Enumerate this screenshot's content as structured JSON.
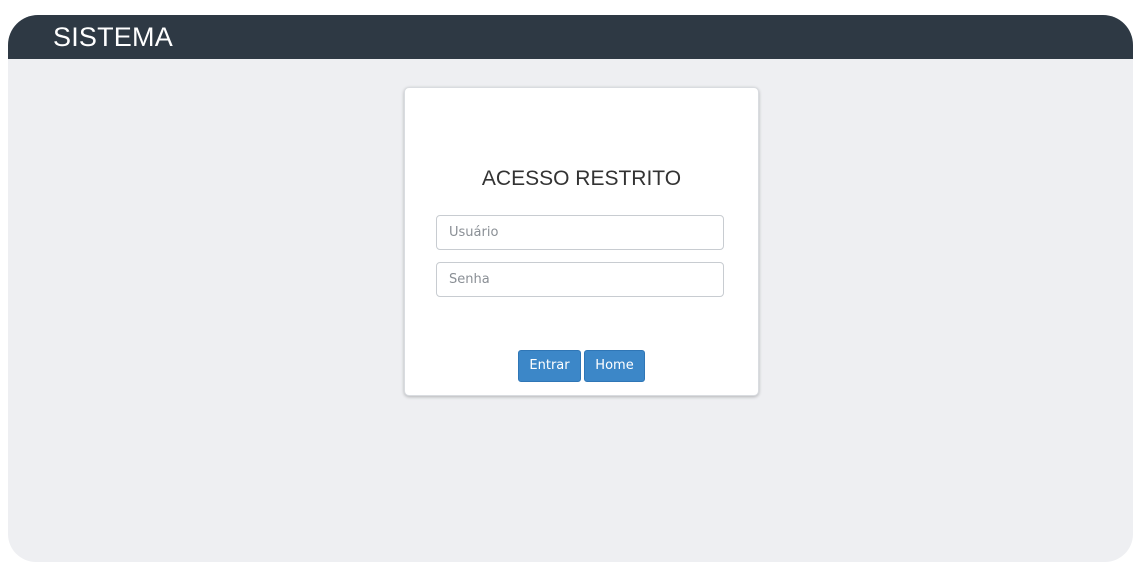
{
  "header": {
    "title": "SISTEMA"
  },
  "login": {
    "heading": "ACESSO RESTRITO",
    "username": {
      "value": "",
      "placeholder": "Usuário"
    },
    "password": {
      "value": "",
      "placeholder": "Senha"
    },
    "buttons": {
      "submit_label": "Entrar",
      "home_label": "Home"
    }
  },
  "colors": {
    "header_bg": "#2e3944",
    "page_bg": "#eeeff2",
    "button_bg": "#3c87c8"
  }
}
